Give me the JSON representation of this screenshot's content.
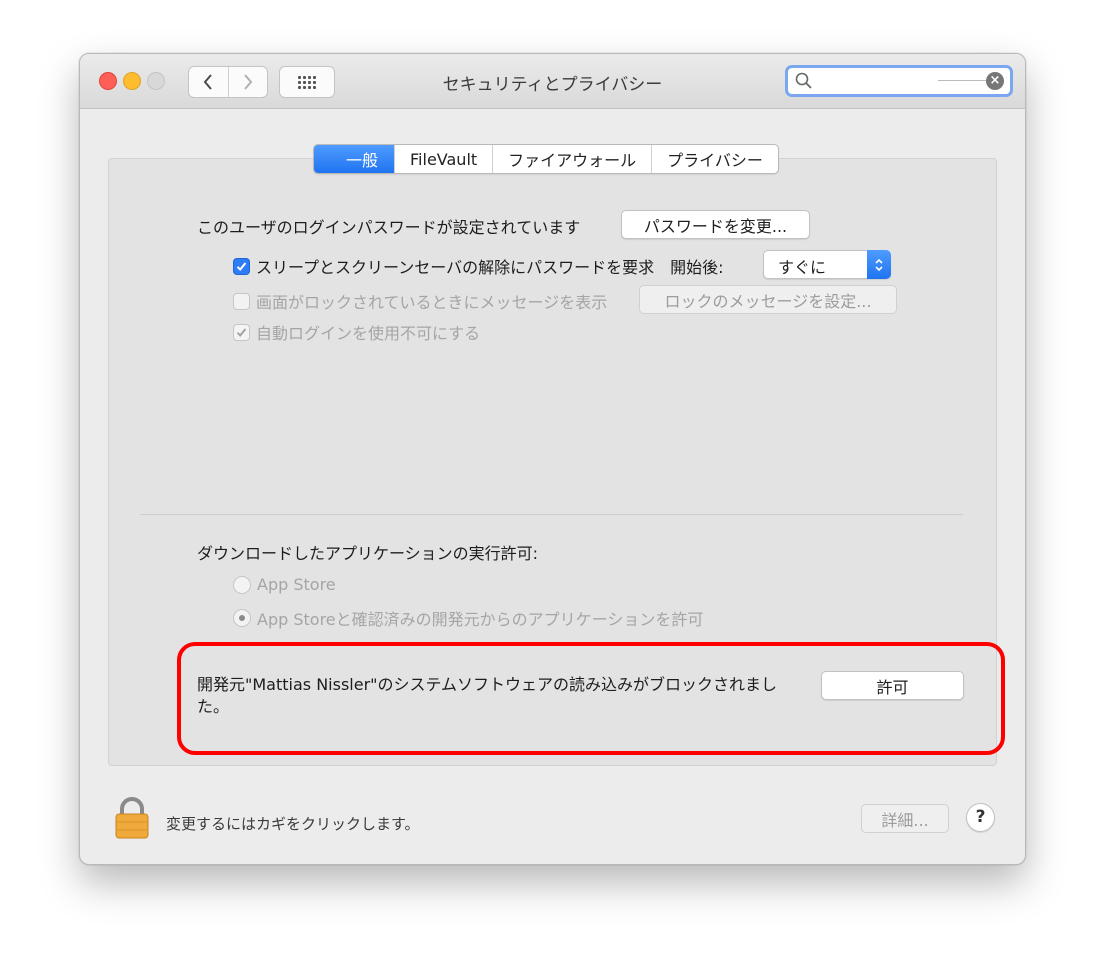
{
  "window": {
    "title": "セキュリティとプライバシー"
  },
  "search": {
    "placeholder": ""
  },
  "tabs": [
    {
      "label": "一般"
    },
    {
      "label": "FileVault"
    },
    {
      "label": "ファイアウォール"
    },
    {
      "label": "プライバシー"
    }
  ],
  "general": {
    "password_status": "このユーザのログインパスワードが設定されています",
    "change_password_button": "パスワードを変更...",
    "require_password_label": "スリープとスクリーンセーバの解除にパスワードを要求",
    "start_after_label": "開始後:",
    "start_after_value": "すぐに",
    "show_message_label": "画面がロックされているときにメッセージを表示",
    "set_lock_message_button": "ロックのメッセージを設定...",
    "disable_autologin_label": "自動ログインを使用不可にする"
  },
  "downloads": {
    "heading": "ダウンロードしたアプリケーションの実行許可:",
    "option_app_store": "App Store",
    "option_app_store_identified": "App Storeと確認済みの開発元からのアプリケーションを許可",
    "blocked_message": "開発元\"Mattias Nissler\"のシステムソフトウェアの読み込みがブロックされました。",
    "allow_button": "許可"
  },
  "footer": {
    "lock_text": "変更するにはカギをクリックします。",
    "advanced_button": "詳細...",
    "help_button": "?"
  },
  "icons": {
    "back": "chevron-left-icon",
    "forward": "chevron-right-icon",
    "show_all": "grid-icon",
    "search": "magnifier-icon",
    "clear": "clear-icon",
    "lock": "lock-icon"
  },
  "colors": {
    "accent": "#2e7cf6",
    "highlight": "#ff0000"
  }
}
